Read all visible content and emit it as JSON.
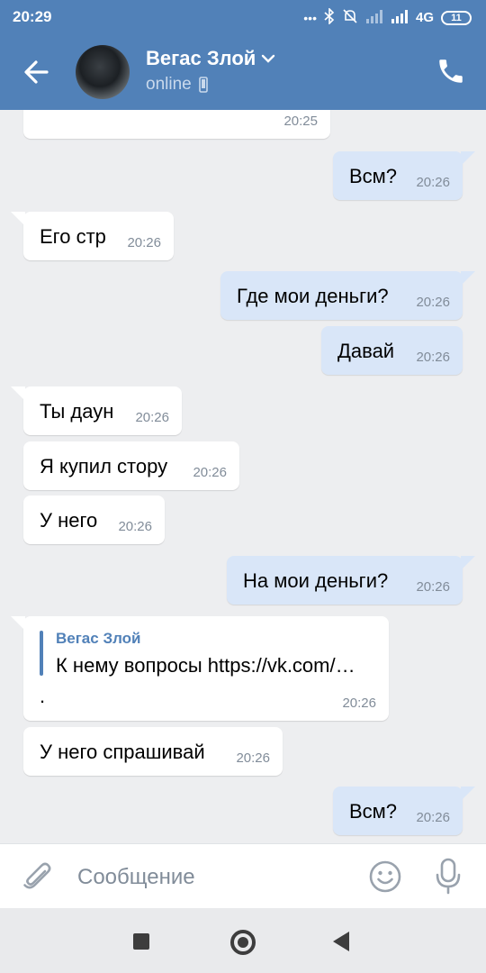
{
  "status_bar": {
    "time": "20:29",
    "network": "4G",
    "battery": "11"
  },
  "header": {
    "name": "Вегас Злой",
    "status": "online"
  },
  "messages": [
    {
      "dir": "in",
      "text": "",
      "time": "20:25"
    },
    {
      "dir": "out",
      "text": "Всм?",
      "time": "20:26"
    },
    {
      "dir": "in",
      "text": "Его стр",
      "time": "20:26"
    },
    {
      "dir": "out",
      "text": "Где мои деньги?",
      "time": "20:26"
    },
    {
      "dir": "out",
      "text": "Давай",
      "time": "20:26"
    },
    {
      "dir": "in",
      "text": "Ты даун",
      "time": "20:26"
    },
    {
      "dir": "in",
      "text": "Я купил стору",
      "time": "20:26"
    },
    {
      "dir": "in",
      "text": "У него",
      "time": "20:26"
    },
    {
      "dir": "out",
      "text": "На мои деньги?",
      "time": "20:26"
    },
    {
      "dir": "in",
      "reply_author": "Вегас Злой",
      "reply_text": "К нему вопросы  https://vk.com/…",
      "text": ".",
      "time": "20:26"
    },
    {
      "dir": "in",
      "text": "У него спрашивай",
      "time": "20:26"
    },
    {
      "dir": "out",
      "text": "Всм?",
      "time": "20:26"
    }
  ],
  "composer": {
    "placeholder": "Сообщение"
  },
  "colors": {
    "header_bg": "#5181b8",
    "chat_bg": "#edeef0",
    "outgoing_bubble": "#d9e6f8",
    "incoming_bubble": "#ffffff",
    "time_text": "#818c99"
  },
  "icons": {
    "back": "arrow-left-icon",
    "phone": "phone-icon",
    "attach": "paperclip-icon",
    "emoji": "smiley-icon",
    "mic": "microphone-icon"
  }
}
